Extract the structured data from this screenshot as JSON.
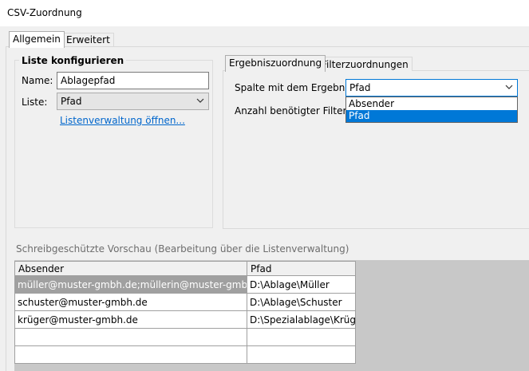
{
  "window": {
    "title": "CSV-Zuordnung"
  },
  "tabs": [
    {
      "label": "Allgemein",
      "active": true
    },
    {
      "label": "Erweitert",
      "active": false
    }
  ],
  "config_group": {
    "title": "Liste konfigurieren",
    "name_label": "Name:",
    "name_value": "Ablagepfad",
    "list_label": "Liste:",
    "list_value": "Pfad",
    "list_link": "Listenverwaltung öffnen..."
  },
  "inner_tabs": [
    {
      "label": "Ergebniszuordnung",
      "active": true
    },
    {
      "label": "Filterzuordnungen",
      "active": false
    }
  ],
  "result": {
    "column_label": "Spalte mit dem Ergebnis:",
    "column_value": "Pfad",
    "filter_count_label": "Anzahl benötigter Filter:",
    "dropdown_options": [
      "Absender",
      "Pfad"
    ],
    "dropdown_selected": "Pfad"
  },
  "preview": {
    "label": "Schreibgeschützte Vorschau (Bearbeitung über die Listenverwaltung)",
    "columns": [
      "Absender",
      "Pfad"
    ],
    "rows": [
      [
        "müller@muster-gmbh.de;müllerin@muster-gmbh.de",
        "D:\\Ablage\\Müller"
      ],
      [
        "schuster@muster-gmbh.de",
        "D:\\Ablage\\Schuster"
      ],
      [
        "krüger@muster-gmbh.de",
        "D:\\Spezialablage\\Krüger"
      ],
      [
        "",
        ""
      ],
      [
        "",
        ""
      ]
    ]
  },
  "colors": {
    "accent": "#0078d7",
    "link": "#0066cc",
    "selected_row": "#a0a0a0"
  },
  "icons": {
    "combo_arrow": "chevron-down-icon"
  }
}
